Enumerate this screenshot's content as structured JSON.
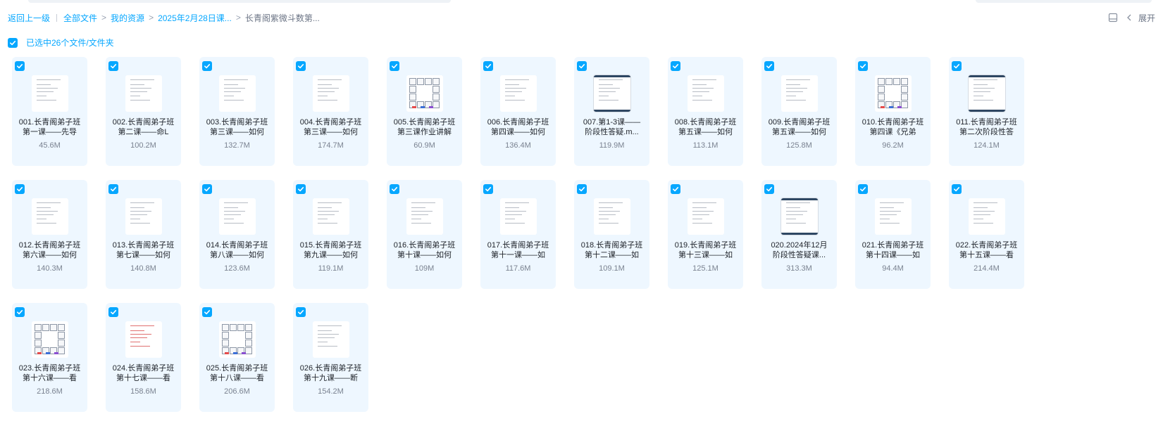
{
  "breadcrumb": {
    "back_label": "返回上一级",
    "items": [
      "全部文件",
      "我的资源",
      "2025年2月28日课...",
      "长青阁紫微斗数第..."
    ],
    "separator": ">"
  },
  "toolbar": {
    "expand_label": "展开",
    "layout_icon": "panel-icon",
    "collapse_icon": "chevron-left-icon"
  },
  "selection": {
    "label": "已选中26个文件/文件夹",
    "checked": true
  },
  "colors": {
    "accent": "#06a7ff",
    "tile_background": "#eef7ff",
    "text": "#1f2329",
    "muted": "#7a8290"
  },
  "files": [
    {
      "name_line1": "001.长青阁弟子班",
      "name_line2": "第一课——先导",
      "size": "45.6M",
      "thumb": "text",
      "checked": true
    },
    {
      "name_line1": "002.长青阁弟子班",
      "name_line2": "第二课——命L",
      "size": "100.2M",
      "thumb": "text",
      "checked": true
    },
    {
      "name_line1": "003.长青阁弟子班",
      "name_line2": "第三课——如何",
      "size": "132.7M",
      "thumb": "text",
      "checked": true
    },
    {
      "name_line1": "004.长青阁弟子班",
      "name_line2": "第三课——如何",
      "size": "174.7M",
      "thumb": "text",
      "checked": true
    },
    {
      "name_line1": "005.长青阁弟子班",
      "name_line2": "第三课作业讲解",
      "size": "60.9M",
      "thumb": "chart",
      "checked": true
    },
    {
      "name_line1": "006.长青阁弟子班",
      "name_line2": "第四课——如何",
      "size": "136.4M",
      "thumb": "text",
      "checked": true
    },
    {
      "name_line1": "007.第1-3课——",
      "name_line2": "阶段性答疑.m...",
      "size": "119.9M",
      "thumb": "dark",
      "checked": true
    },
    {
      "name_line1": "008.长青阁弟子班",
      "name_line2": "第五课——如何",
      "size": "113.1M",
      "thumb": "text",
      "checked": true
    },
    {
      "name_line1": "009.长青阁弟子班",
      "name_line2": "第五课——如何",
      "size": "125.8M",
      "thumb": "text",
      "checked": true
    },
    {
      "name_line1": "010.长青阁弟子班",
      "name_line2": "第四课《兄弟",
      "size": "96.2M",
      "thumb": "chart",
      "checked": true
    },
    {
      "name_line1": "011.长青阁弟子班",
      "name_line2": "第二次阶段性答",
      "size": "124.1M",
      "thumb": "dark",
      "checked": true
    },
    {
      "name_line1": "012.长青阁弟子班",
      "name_line2": "第六课——如何",
      "size": "140.3M",
      "thumb": "text",
      "checked": true
    },
    {
      "name_line1": "013.长青阁弟子班",
      "name_line2": "第七课——如何",
      "size": "140.8M",
      "thumb": "text",
      "checked": true
    },
    {
      "name_line1": "014.长青阁弟子班",
      "name_line2": "第八课——如何",
      "size": "123.6M",
      "thumb": "text",
      "checked": true
    },
    {
      "name_line1": "015.长青阁弟子班",
      "name_line2": "第九课——如何",
      "size": "119.1M",
      "thumb": "text",
      "checked": true
    },
    {
      "name_line1": "016.长青阁弟子班",
      "name_line2": "第十课——如何",
      "size": "109M",
      "thumb": "text",
      "checked": true
    },
    {
      "name_line1": "017.长青阁弟子班",
      "name_line2": "第十一课——如",
      "size": "117.6M",
      "thumb": "text",
      "checked": true
    },
    {
      "name_line1": "018.长青阁弟子班",
      "name_line2": "第十二课——如",
      "size": "109.1M",
      "thumb": "text",
      "checked": true
    },
    {
      "name_line1": "019.长青阁弟子班",
      "name_line2": "第十三课——如",
      "size": "125.1M",
      "thumb": "text",
      "checked": true
    },
    {
      "name_line1": "020.2024年12月",
      "name_line2": "阶段性答疑课...",
      "size": "313.3M",
      "thumb": "dark",
      "checked": true
    },
    {
      "name_line1": "021.长青阁弟子班",
      "name_line2": "第十四课——如",
      "size": "94.4M",
      "thumb": "text",
      "checked": true
    },
    {
      "name_line1": "022.长青阁弟子班",
      "name_line2": "第十五课——看",
      "size": "214.4M",
      "thumb": "text",
      "checked": true
    },
    {
      "name_line1": "023.长青阁弟子班",
      "name_line2": "第十六课——看",
      "size": "218.6M",
      "thumb": "chart",
      "checked": true
    },
    {
      "name_line1": "024.长青阁弟子班",
      "name_line2": "第十七课——看",
      "size": "158.6M",
      "thumb": "red",
      "checked": true
    },
    {
      "name_line1": "025.长青阁弟子班",
      "name_line2": "第十八课——看",
      "size": "206.6M",
      "thumb": "chart",
      "checked": true
    },
    {
      "name_line1": "026.长青阁弟子班",
      "name_line2": "第十九课——断",
      "size": "154.2M",
      "thumb": "text",
      "checked": true
    }
  ]
}
